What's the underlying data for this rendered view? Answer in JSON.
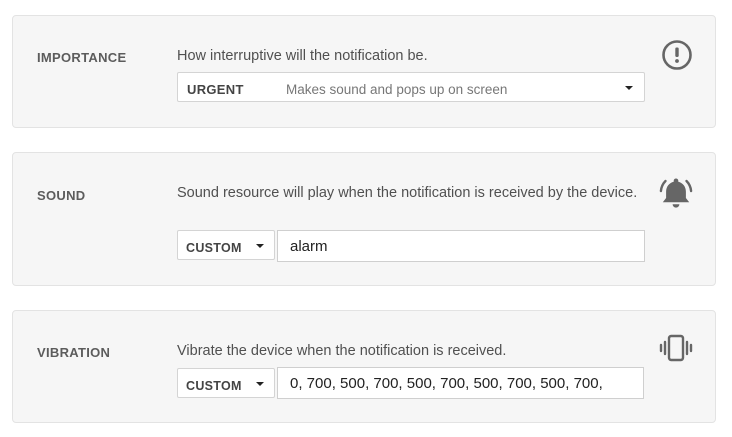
{
  "importance": {
    "label": "IMPORTANCE",
    "description": "How interruptive will the notification be.",
    "select_value": "URGENT",
    "select_description": "Makes sound and pops up on screen",
    "icon": "exclamation-circle-icon"
  },
  "sound": {
    "label": "SOUND",
    "description": "Sound resource will play when the notification is received by the device.",
    "select_value": "CUSTOM",
    "input_value": "alarm",
    "icon": "bell-icon"
  },
  "vibration": {
    "label": "VIBRATION",
    "description": "Vibrate the device when the notification is received.",
    "select_value": "CUSTOM",
    "input_value": "0, 700, 500, 700, 500, 700, 500, 700, 500, 700,",
    "icon": "phone-vibrate-icon"
  }
}
